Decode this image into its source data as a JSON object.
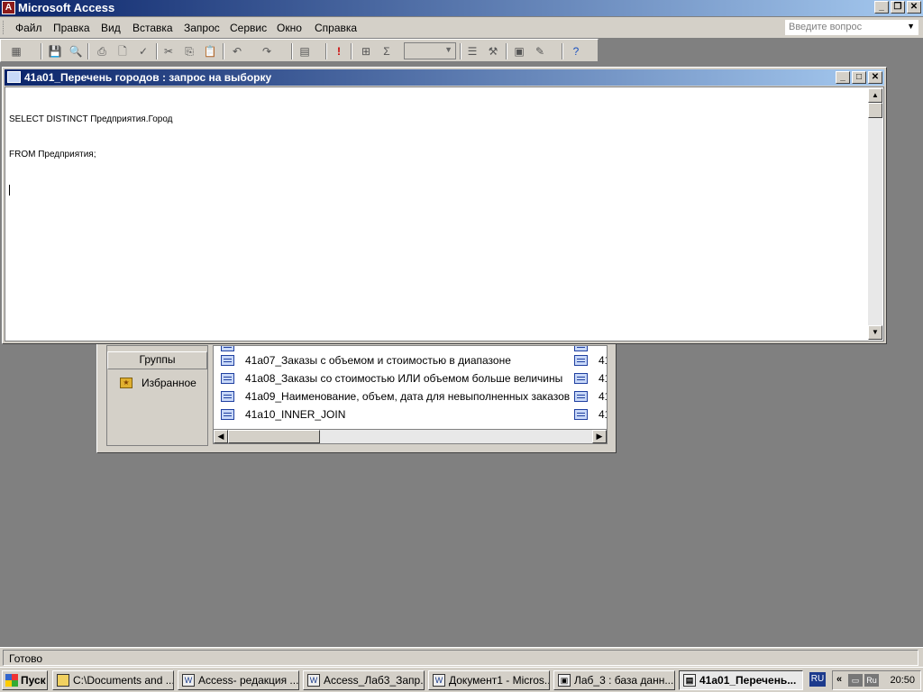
{
  "app": {
    "title": "Microsoft Access",
    "icon": "access-app-icon"
  },
  "menu": {
    "items": [
      "Файл",
      "Правка",
      "Вид",
      "Вставка",
      "Запрос",
      "Сервис",
      "Окно",
      "Справка"
    ],
    "help_placeholder": "Введите вопрос"
  },
  "query_window": {
    "title": "41a01_Перечень городов : запрос на выборку",
    "sql_lines": [
      "SELECT DISTINCT Предприятия.Город",
      "FROM Предприятия;"
    ]
  },
  "db_window": {
    "groups_label": "Группы",
    "favorites_label": "Избранное",
    "queries": [
      "41a07_Заказы с объемом и стоимостью в диапазоне",
      "41a08_Заказы со стоимостью ИЛИ объемом больше величины",
      "41a09_Наименование, объем, дата для невыполненных заказов",
      "41a10_INNER_JOIN"
    ],
    "second_column_prefix": "41"
  },
  "status": {
    "text": "Готово"
  },
  "taskbar": {
    "start_label": "Пуск",
    "tasks": [
      "C:\\Documents and ...",
      "Access- редакция ...",
      "Access_Лаб3_Запр...",
      "Документ1 - Micros...",
      "Лаб_3 : база данн...",
      "41a01_Перечень..."
    ],
    "lang": "RU",
    "tray_arrows": "«",
    "tray_lang": "Ru",
    "clock": "20:50"
  }
}
